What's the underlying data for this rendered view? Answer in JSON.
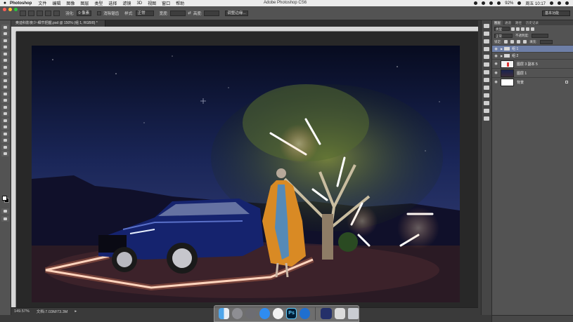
{
  "menubar": {
    "apple": "",
    "app_name": "Photoshop",
    "items": [
      "文件",
      "编辑",
      "图像",
      "图层",
      "类型",
      "选择",
      "滤镜",
      "3D",
      "视图",
      "窗口",
      "帮助"
    ],
    "window_title": "Adobe Photoshop CS6",
    "battery": "92%",
    "clock": "周五 10:17"
  },
  "options_bar": {
    "feather_label": "羽化:",
    "feather_value": "0 像素",
    "antialias_label": "消除锯齿",
    "style_label": "样式:",
    "style_value": "正常",
    "width_label": "宽度:",
    "height_label": "高度:",
    "refine_edge": "调整边缘...",
    "workspace": "基本功能"
  },
  "document": {
    "tab_title": "奥迪科影夜少-细节把握.psd @ 150% (组 1, RGB/8) *",
    "zoom": "149.57%",
    "doc_size": "文档:7.03M/73.3M"
  },
  "layers_panel": {
    "tabs": [
      "图层",
      "通道",
      "路径",
      "历史记录"
    ],
    "kind": "类型",
    "blend_mode": "正常",
    "opacity_label": "不透明度:",
    "lock_label": "锁定:",
    "fill_label": "填充:",
    "layers": [
      {
        "name": "组 1",
        "kind": "group",
        "selected": true
      },
      {
        "name": "组 2",
        "kind": "group",
        "selected": false
      },
      {
        "name": "图层 3 副本 5",
        "kind": "layer",
        "selected": false
      },
      {
        "name": "图层 1",
        "kind": "layer",
        "selected": false
      },
      {
        "name": "背景",
        "kind": "background",
        "selected": false
      }
    ]
  },
  "dock": {
    "ps_label": "Ps",
    "apps": [
      "finder-icon",
      "launchpad-icon",
      "system-preferences-icon",
      "safari-icon",
      "qq-icon",
      "photoshop-icon",
      "browser-icon",
      "screen-icon",
      "keyboard-icon",
      "trash-icon"
    ]
  },
  "colors": {
    "accent_selected": "#6e7fa7",
    "panel_bg": "#535353",
    "canvas_bg": "#282828"
  }
}
